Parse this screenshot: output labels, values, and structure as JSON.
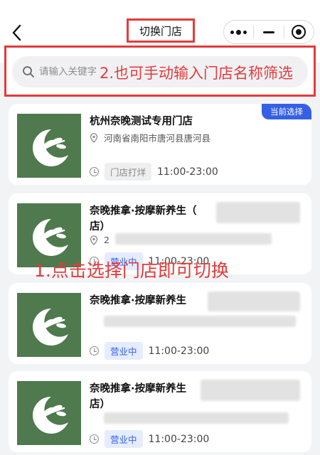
{
  "header": {
    "title": "切换门店"
  },
  "search": {
    "placeholder": "请输入关键字"
  },
  "annotations": {
    "step1": "1.点击选择门店即可切换",
    "step2": "2.也可手动输入门店名称筛选"
  },
  "stores": [
    {
      "name": "杭州奈晚测试专用门店",
      "address": "河南省南阳市唐河县唐河县",
      "status": "门店打烊",
      "hours": "11:00-23:00",
      "current_label": "当前选择"
    },
    {
      "name": "奈晚推拿·按摩新养生（",
      "name_line2": "店）",
      "address": "2",
      "status": "营业中",
      "hours": "11:00-23:00"
    },
    {
      "name": "奈晚推拿·按摩新养生",
      "status": "营业中",
      "hours": "11:00-23:00"
    },
    {
      "name": "奈晚推拿·按摩新养生",
      "name_line2": "店）",
      "status": "营业中",
      "hours": "11:00-23:00"
    }
  ],
  "colors": {
    "accent_red": "#e43b3b",
    "brand_blue": "#3560e6",
    "logo_green": "#4e7a4e"
  }
}
